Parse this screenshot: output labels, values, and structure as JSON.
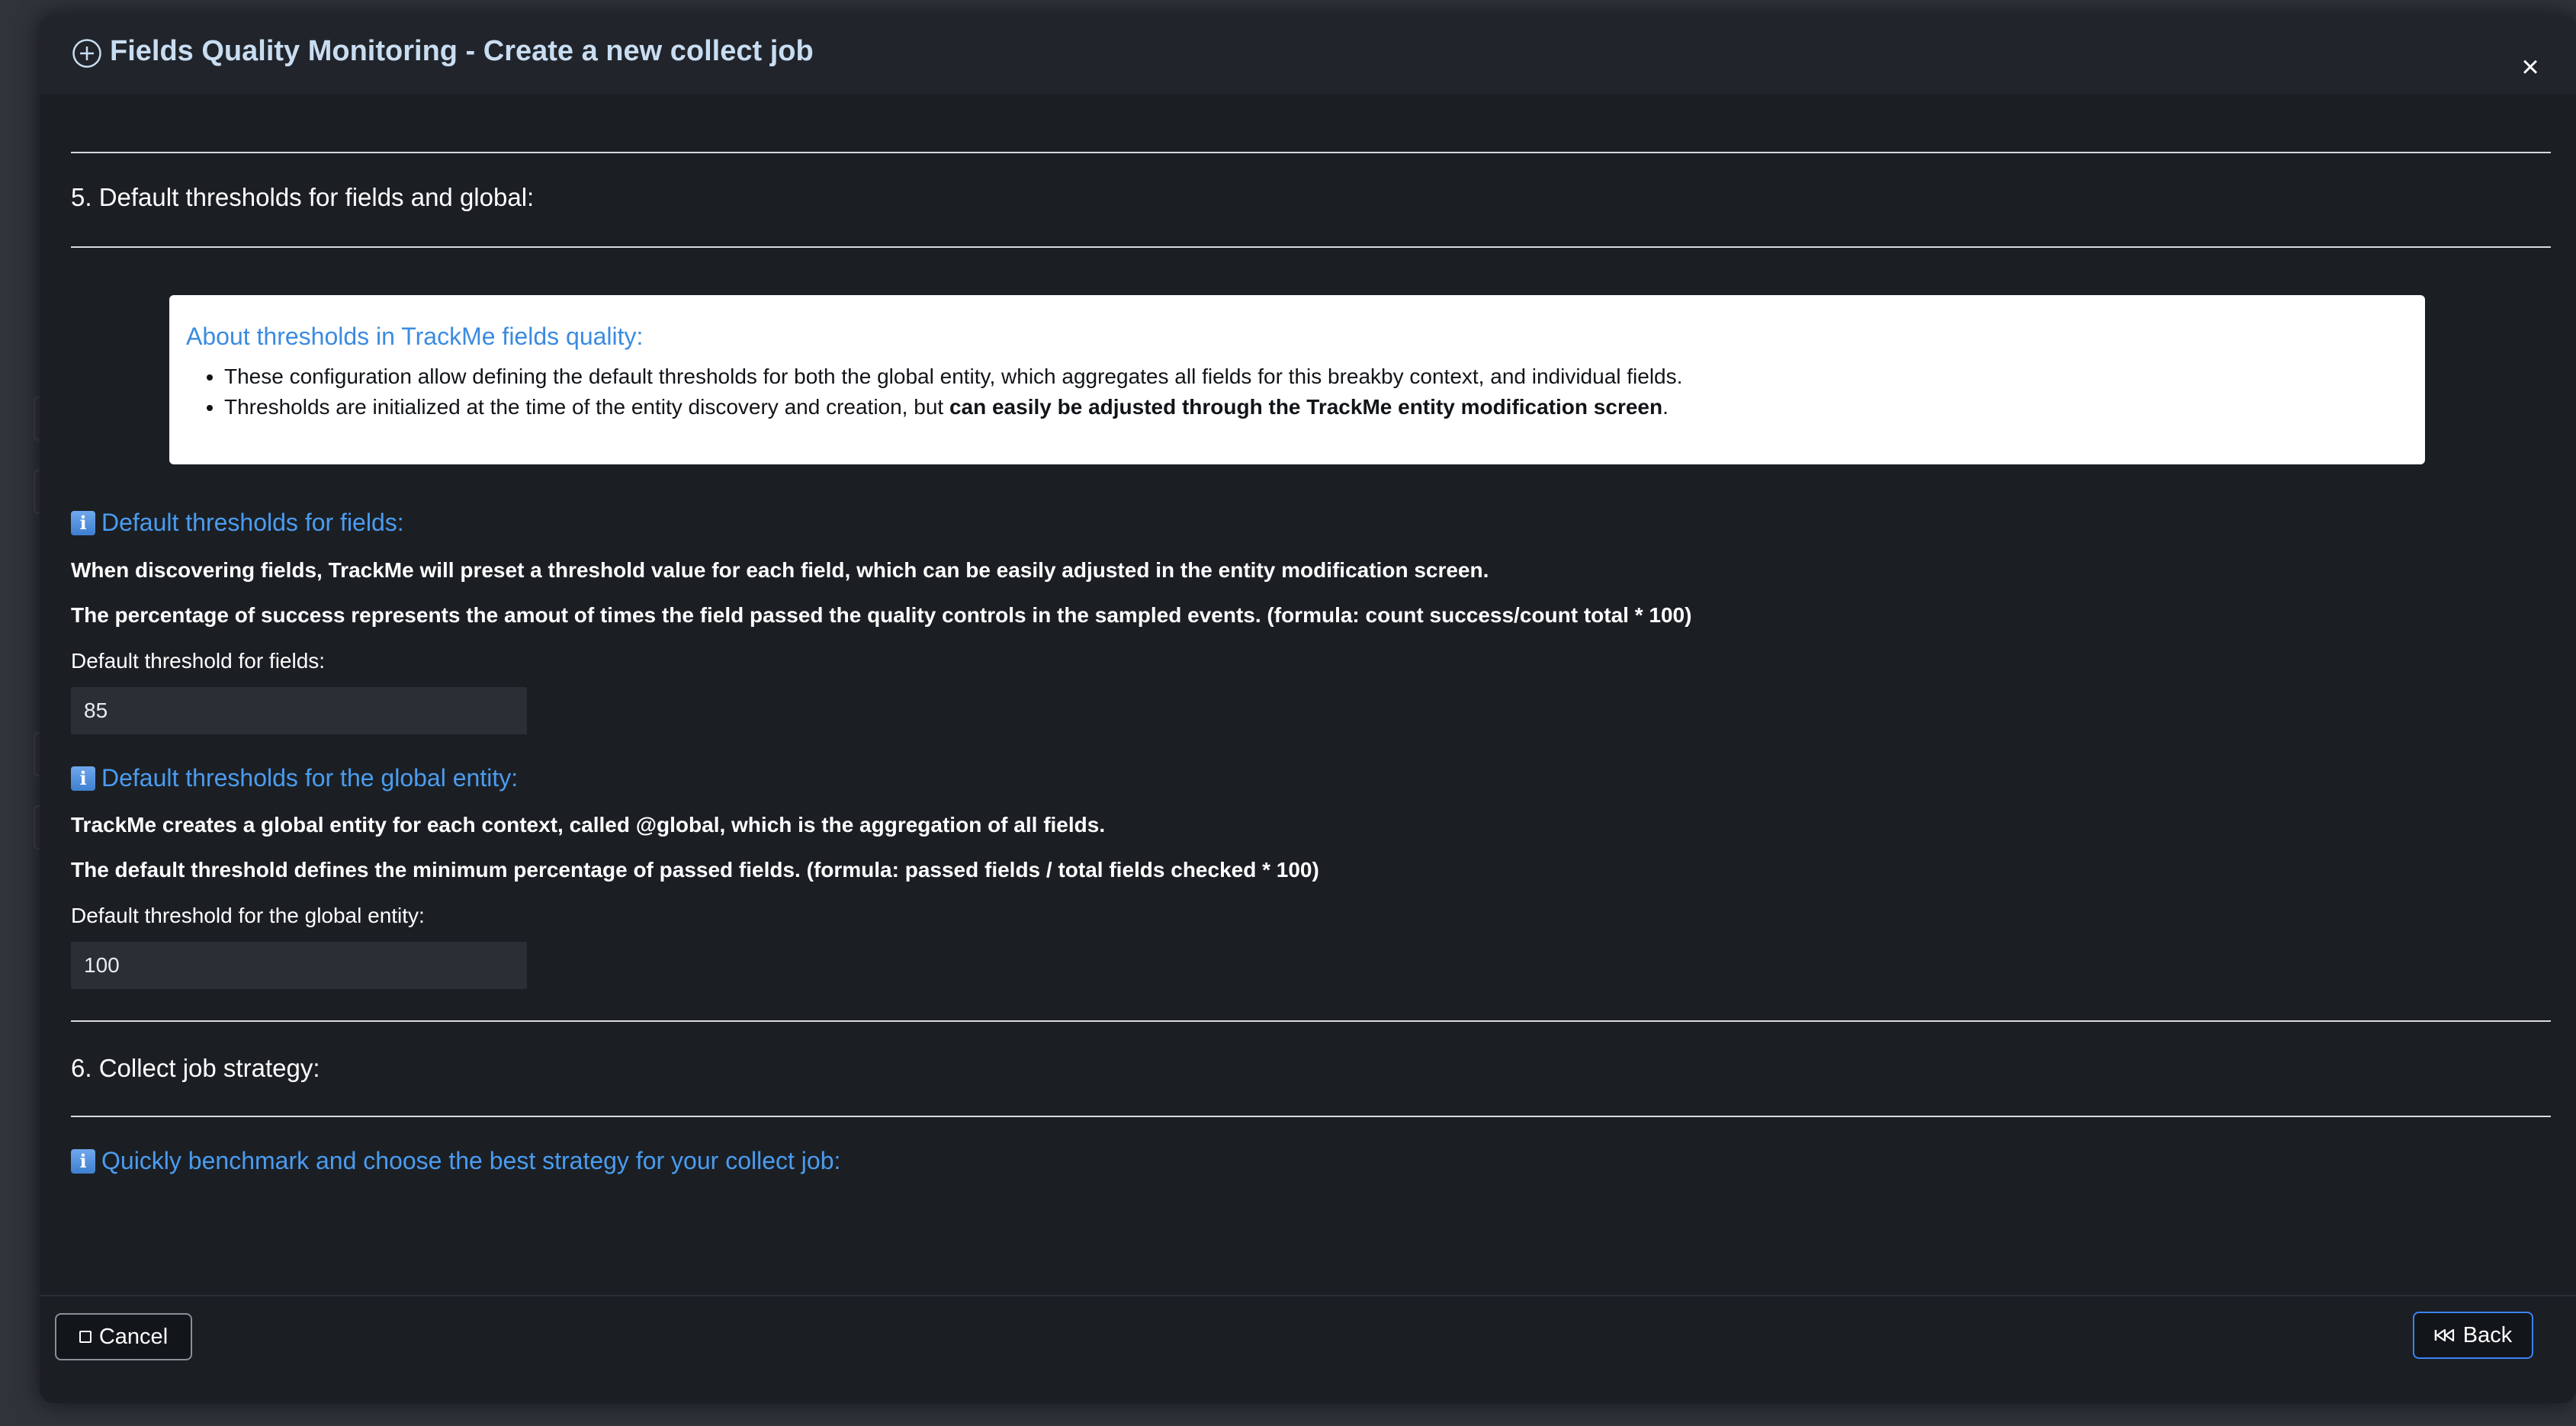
{
  "modal": {
    "title": "Fields Quality Monitoring - Create a new collect job",
    "close_label": "×"
  },
  "section5": {
    "heading": "5. Default thresholds for fields and global:"
  },
  "about": {
    "title": "About thresholds in TrackMe fields quality:",
    "item1": "These configuration allow defining the default thresholds for both the global entity, which aggregates all fields for this breakby context, and individual fields.",
    "item2_prefix": "Thresholds are initialized at the time of the entity discovery and creation, but ",
    "item2_bold": "can easily be adjusted through the TrackMe entity modification screen",
    "item2_suffix": "."
  },
  "fields_thresholds": {
    "heading": "Default thresholds for fields:",
    "desc1": "When discovering fields, TrackMe will preset a threshold value for each field, which can be easily adjusted in the entity modification screen.",
    "desc2": "The percentage of success represents the amout of times the field passed the quality controls in the sampled events. (formula: count success/count total * 100)",
    "input_label": "Default threshold for fields:",
    "input_value": "85"
  },
  "global_thresholds": {
    "heading": "Default thresholds for the global entity:",
    "desc1": "TrackMe creates a global entity for each context, called @global, which is the aggregation of all fields.",
    "desc2": "The default threshold defines the minimum percentage of passed fields. (formula: passed fields / total fields checked * 100)",
    "input_label": "Default threshold for the global entity:",
    "input_value": "100"
  },
  "section6": {
    "heading": "6. Collect job strategy:",
    "sub_heading": "Quickly benchmark and choose the best strategy for your collect job:"
  },
  "footer": {
    "cancel_label": "Cancel",
    "back_label": "Back"
  }
}
